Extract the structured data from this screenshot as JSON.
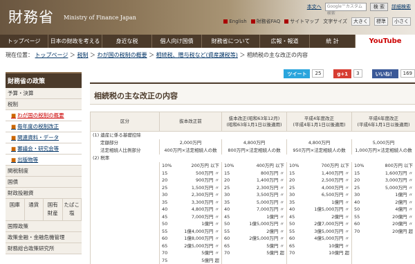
{
  "header": {
    "logo": "財務省",
    "logo_en": "Ministry of Finance Japan",
    "utility": [
      "本文へ"
    ],
    "search_placeholder": "Google™カスタム検索",
    "search_btn": "検 索",
    "detail_search": "詳細検索",
    "links": [
      "English",
      "財務省FAQ",
      "サイトマップ"
    ],
    "text_size_label": "文字サイズ",
    "size_big": "大きく",
    "size_std": "標準",
    "size_small": "小さく"
  },
  "nav": [
    "トップページ",
    "日本の財政を考える",
    "身近な税",
    "個人向け国債",
    "財務省について",
    "広報・報道",
    "統 計",
    "YouTube"
  ],
  "breadcrumb": {
    "prefix": "現在位置：",
    "items": [
      "トップページ",
      "税制",
      "わが国の税制の概要",
      "相続税、贈与税など(資産課税等)"
    ],
    "current": "相続税の主な改正の内容"
  },
  "sidebar": {
    "title": "財務省の政策",
    "items": [
      "予算・決算",
      "税制"
    ],
    "subitems": [
      "わが国の税制の概要",
      "毎年度の税制改正",
      "関連資料・データ",
      "審議会・研究会等",
      "出版物等"
    ],
    "items2": [
      "関税制度",
      "国債",
      "財政投融資"
    ],
    "grid": [
      "国庫",
      "通貨",
      "国有\n財産",
      "たばこ\n塩"
    ],
    "items3": [
      "国際政策",
      "政策金融・金融危機管理",
      "財務総合政策研究所"
    ]
  },
  "social": {
    "tweet": "ツイート",
    "tweet_count": "25",
    "gplus": "g+1",
    "gplus_count": "3",
    "like": "いいね！",
    "like_count": "169"
  },
  "page_title": "相続税の主な改正の内容",
  "table": {
    "headers": [
      "区分",
      "抜本改正前",
      "抜本改正(昭和63年12月)\n(昭和63年1月1日以後適用)",
      "平成4年度改正\n(平成4年1月1日以後適用)",
      "平成6年度改正\n(平成6年1月1日以後適用)"
    ],
    "sec1": "(1) 遺産に係る基礎控除",
    "rows1": [
      [
        "定額部分",
        "2,000万円",
        "4,800万円",
        "4,800万円",
        "5,000万円"
      ],
      [
        "法定相続人比例部分",
        "400万円×法定相続人の数",
        "800万円×法定相続人の数",
        "950万円×法定相続人の数",
        "1,000万円×法定相続人の数"
      ]
    ],
    "sec2": "(2) 税率",
    "rates": [
      [
        [
          "10%",
          "200万円 以下"
        ],
        [
          "10%",
          "400万円 以下"
        ],
        [
          "10%",
          "700万円 以下"
        ],
        [
          "10%",
          "800万円 以下"
        ]
      ],
      [
        [
          "15",
          "500万円 〃"
        ],
        [
          "15",
          "800万円 〃"
        ],
        [
          "15",
          "1,400万円 〃"
        ],
        [
          "15",
          "1,600万円 〃"
        ]
      ],
      [
        [
          "20",
          "900万円 〃"
        ],
        [
          "20",
          "1,400万円 〃"
        ],
        [
          "20",
          "2,500万円 〃"
        ],
        [
          "20",
          "3,000万円 〃"
        ]
      ],
      [
        [
          "25",
          "1,500万円 〃"
        ],
        [
          "25",
          "2,300万円 〃"
        ],
        [
          "25",
          "4,000万円 〃"
        ],
        [
          "25",
          "5,000万円 〃"
        ]
      ],
      [
        [
          "30",
          "2,300万円 〃"
        ],
        [
          "30",
          "3,500万円 〃"
        ],
        [
          "30",
          "6,500万円 〃"
        ],
        [
          "30",
          "1億円 〃"
        ]
      ],
      [
        [
          "35",
          "3,300万円 〃"
        ],
        [
          "35",
          "5,000万円 〃"
        ],
        [
          "35",
          "1億円 〃"
        ],
        [
          "40",
          "2億円 〃"
        ]
      ],
      [
        [
          "40",
          "4,800万円 〃"
        ],
        [
          "40",
          "7,000万円 〃"
        ],
        [
          "40",
          "1億5,000万円 〃"
        ],
        [
          "50",
          "4億円 〃"
        ]
      ],
      [
        [
          "45",
          "7,000万円 〃"
        ],
        [
          "45",
          "1億円 〃"
        ],
        [
          "45",
          "2億円 〃"
        ],
        [
          "55",
          "20億円 〃"
        ]
      ],
      [
        [
          "50",
          "1億円 〃"
        ],
        [
          "50",
          "1億5,000万円 〃"
        ],
        [
          "50",
          "2億7,000万円 〃"
        ],
        [
          "60",
          "20億円 〃"
        ]
      ],
      [
        [
          "55",
          "1億4,000万円 〃"
        ],
        [
          "55",
          "2億円 〃"
        ],
        [
          "55",
          "3億5,000万円 〃"
        ],
        [
          "70",
          "20億円 超"
        ]
      ],
      [
        [
          "60",
          "1億8,000万円 〃"
        ],
        [
          "60",
          "2億5,000万円 〃"
        ],
        [
          "60",
          "4億5,000万円 〃"
        ],
        [
          "",
          ""
        ]
      ],
      [
        [
          "65",
          "2億5,000万円 〃"
        ],
        [
          "65",
          "5億円 〃"
        ],
        [
          "65",
          "10億円 〃"
        ],
        [
          "",
          ""
        ]
      ],
      [
        [
          "70",
          "5億円 〃"
        ],
        [
          "70",
          "5億円 超"
        ],
        [
          "70",
          "10億円 超"
        ],
        [
          "",
          ""
        ]
      ],
      [
        [
          "75",
          "5億円 超"
        ],
        [
          "",
          ""
        ],
        [
          "",
          ""
        ],
        [
          "",
          ""
        ]
      ]
    ]
  }
}
